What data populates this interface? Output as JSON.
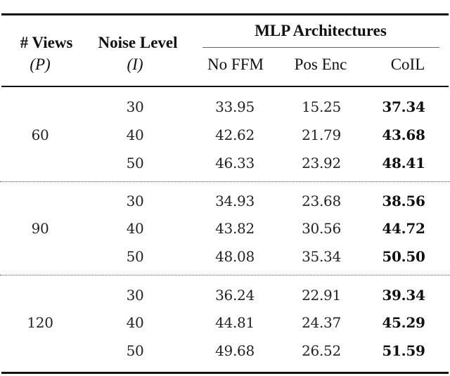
{
  "table": {
    "headers": {
      "views": "# Views",
      "views_symbol": "(P)",
      "noise": "Noise Level",
      "noise_symbol": "(I)",
      "group": "MLP Architectures",
      "columns": [
        "No FFM",
        "Pos Enc",
        "CoIL"
      ]
    },
    "groups": [
      {
        "views": "60",
        "rows": [
          {
            "noise": "30",
            "no_ffm": "33.95",
            "pos_enc": "15.25",
            "coil": "37.34"
          },
          {
            "noise": "40",
            "no_ffm": "42.62",
            "pos_enc": "21.79",
            "coil": "43.68"
          },
          {
            "noise": "50",
            "no_ffm": "46.33",
            "pos_enc": "23.92",
            "coil": "48.41"
          }
        ]
      },
      {
        "views": "90",
        "rows": [
          {
            "noise": "30",
            "no_ffm": "34.93",
            "pos_enc": "23.68",
            "coil": "38.56"
          },
          {
            "noise": "40",
            "no_ffm": "43.82",
            "pos_enc": "30.56",
            "coil": "44.72"
          },
          {
            "noise": "50",
            "no_ffm": "48.08",
            "pos_enc": "35.34",
            "coil": "50.50"
          }
        ]
      },
      {
        "views": "120",
        "rows": [
          {
            "noise": "30",
            "no_ffm": "36.24",
            "pos_enc": "22.91",
            "coil": "39.34"
          },
          {
            "noise": "40",
            "no_ffm": "44.81",
            "pos_enc": "24.37",
            "coil": "45.29"
          },
          {
            "noise": "50",
            "no_ffm": "49.68",
            "pos_enc": "26.52",
            "coil": "51.59"
          }
        ]
      }
    ]
  }
}
